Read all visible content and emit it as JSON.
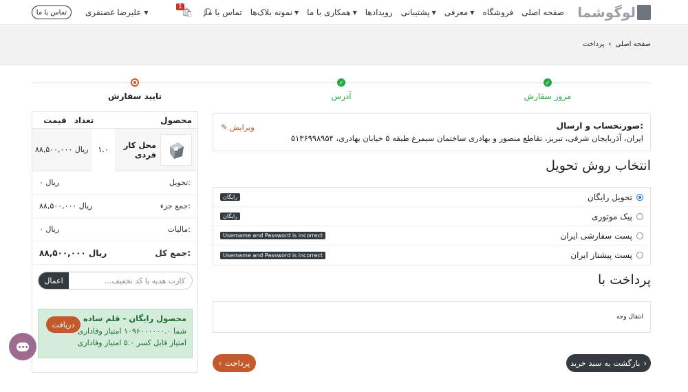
{
  "navbar": {
    "logo_text": "لوگوشما",
    "menu": [
      {
        "label": "صفحه اصلی",
        "dropdown": false
      },
      {
        "label": "فروشگاه",
        "dropdown": false
      },
      {
        "label": "معرفی",
        "dropdown": true
      },
      {
        "label": "پشتیبانی",
        "dropdown": true
      },
      {
        "label": "رویدادها",
        "dropdown": false
      },
      {
        "label": "همکاری با ما",
        "dropdown": true
      },
      {
        "label": "نمونه بلاک‌ها",
        "dropdown": true
      },
      {
        "label": "تماس با ما",
        "dropdown": false
      }
    ],
    "cart_count": "1",
    "user_name": "علیرضا غضنفری",
    "contact_button": "تماس با ما"
  },
  "breadcrumb": {
    "home": "صفحه اصلی",
    "current": "پرداخت"
  },
  "steps": [
    {
      "label": "مرور سفارش",
      "status": "done"
    },
    {
      "label": "آدرس",
      "status": "done"
    },
    {
      "label": "تایید سفارش",
      "status": "current"
    }
  ],
  "summary": {
    "headers": {
      "product": "محصول",
      "qty": "تعداد",
      "price": "قیمت"
    },
    "product": {
      "name": "محل کار فردی",
      "qty": "۱.۰",
      "price": "۸۸,۵۰۰,۰۰۰ ریال"
    },
    "delivery_label": "تحویل:",
    "delivery_value": "۰ ریال",
    "subtotal_label": "جمع جزء:",
    "subtotal_value": "۸۸,۵۰۰,۰۰۰ ریال",
    "tax_label": "مالیات:",
    "tax_value": "۰ ریال",
    "total_label": "جمع کل:",
    "total_value": "۸۸,۵۰۰,۰۰۰ ریال",
    "coupon_placeholder": "کارت هدیه یا کد تخفیف...",
    "coupon_button": "اعمال",
    "promo": {
      "title": "محصول رایگان - قلم ساده",
      "line1": "شما ۱۰۹۶۰۰۰۰۰۰.۰ امتیاز وفاداری",
      "line2": "امتیاز قابل کسر ۵.۰ امتیاز وفاداری",
      "button": "دریافت"
    }
  },
  "address": {
    "title": "صورتحساب و ارسال:",
    "text": "ایران، آذربایجان شرقی، تبریز، تقاطع منصور و بهادری ساختمان سیمرغ طبقه ۵ خیابان بهادری، ۵۱۳۶۹۹۸۹۵۴",
    "edit": "ویرایش"
  },
  "delivery": {
    "heading": "انتخاب روش تحویل",
    "methods": [
      {
        "label": "تحویل رایگان",
        "badge": "رایگان",
        "selected": true
      },
      {
        "label": "پیک موتوری",
        "badge": "رایگان",
        "selected": false
      },
      {
        "label": "پست سفارشی ایران",
        "badge": "Username and Password is incorrect",
        "selected": false
      },
      {
        "label": "پست پیشتاز ایران",
        "badge": "Username and Password is incorrect",
        "selected": false
      }
    ]
  },
  "payment": {
    "heading": "پرداخت با",
    "method": "انتقال وجه"
  },
  "buttons": {
    "back": "بازگشت به سبد خرید",
    "pay": "پرداخت"
  },
  "colors": {
    "accent": "#c45a2c",
    "success": "#28a745",
    "dark": "#343a40",
    "chat": "#9c6b8e"
  }
}
